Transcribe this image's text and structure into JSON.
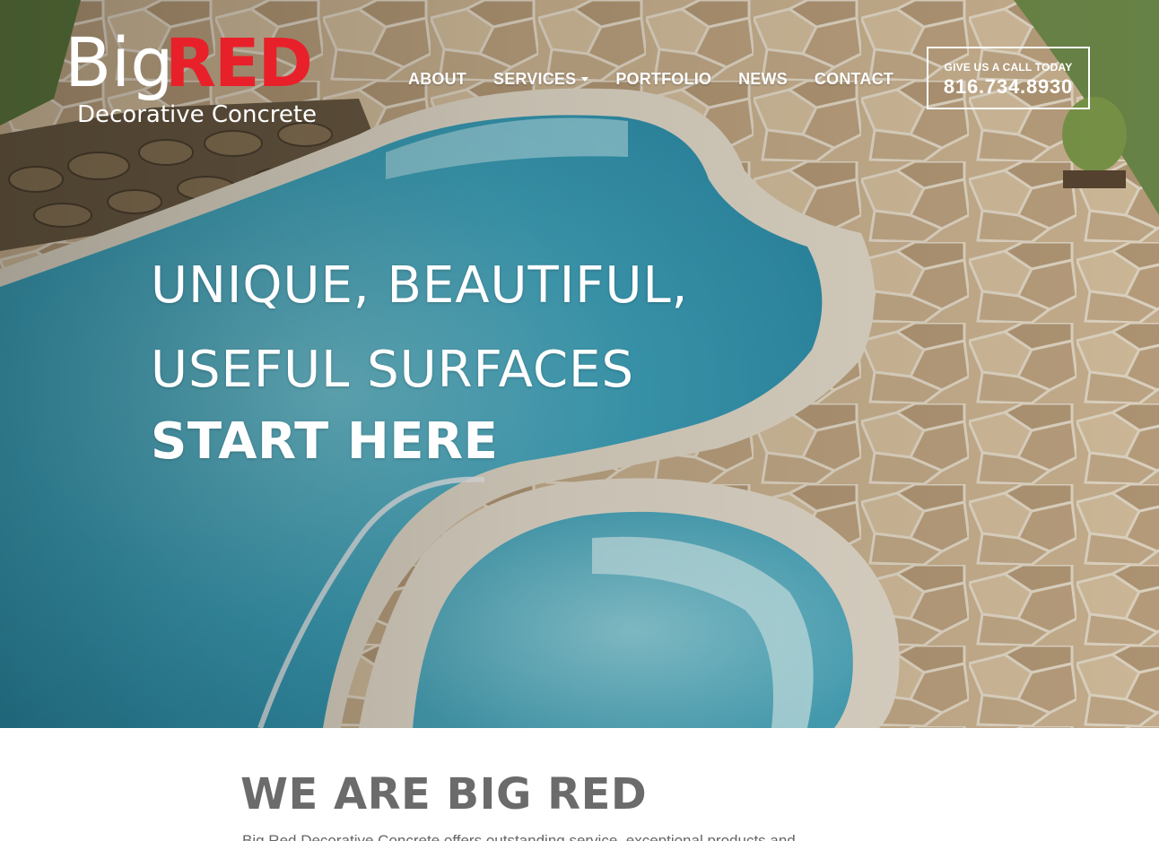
{
  "brand": {
    "logo_big": "Big",
    "logo_red": "RED",
    "logo_tagline": "Decorative Concrete",
    "logo_red_color": "#e8202a"
  },
  "nav": {
    "items": [
      {
        "label": "ABOUT",
        "has_dropdown": false
      },
      {
        "label": "SERVICES",
        "has_dropdown": true
      },
      {
        "label": "PORTFOLIO",
        "has_dropdown": false
      },
      {
        "label": "NEWS",
        "has_dropdown": false
      },
      {
        "label": "CONTACT",
        "has_dropdown": false
      }
    ]
  },
  "call": {
    "label": "GIVE US A CALL TODAY",
    "number": "816.734.8930"
  },
  "hero": {
    "line1": "UNIQUE, BEAUTIFUL,",
    "line2": "USEFUL SURFACES",
    "cta": "START HERE",
    "image_subject": "pool-and-flagstone-deck-photo"
  },
  "intro": {
    "title": "WE ARE BIG RED",
    "body": "Big Red Decorative Concrete offers outstanding service, exceptional products and"
  }
}
